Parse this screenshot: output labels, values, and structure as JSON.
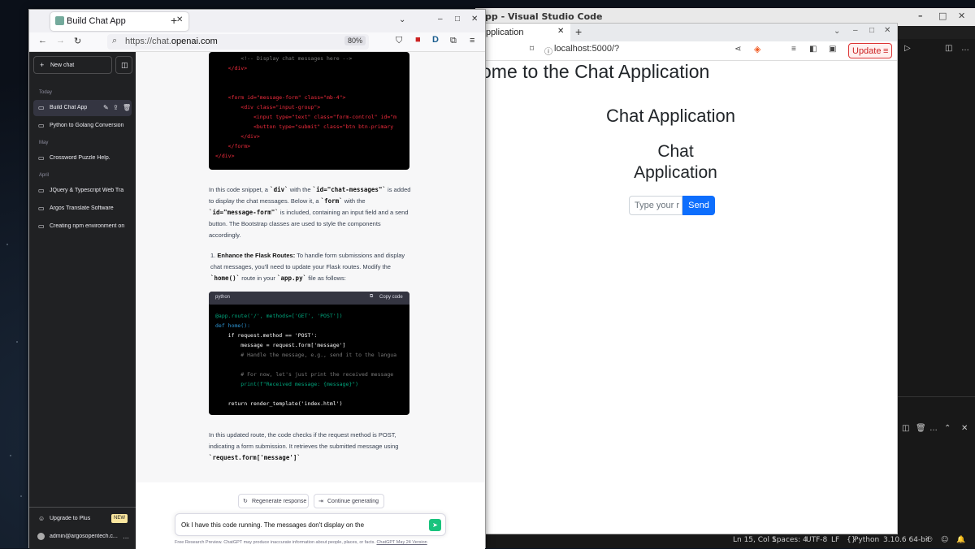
{
  "vscode": {
    "title": "pp - Visual Studio Code",
    "status": {
      "position": "Ln 15, Col 1",
      "spaces": "Spaces: 4",
      "encoding": "UTF-8",
      "eol": "LF",
      "language": "Python",
      "interpreter": "3.10.6 64-bit"
    }
  },
  "brave": {
    "tab_title": "pplication",
    "url": "localhost:5000/?",
    "update_label": "Update",
    "page": {
      "heading_main": "ome to the Chat Application",
      "heading_secondary": "Chat Application",
      "heading_tertiary": "Chat Application",
      "input_placeholder": "Type your r",
      "send_label": "Send"
    }
  },
  "firefox": {
    "tab_title": "Build Chat App",
    "url_prefix": "https://chat.",
    "url_domain": "openai.com",
    "zoom": "80%"
  },
  "sidebar": {
    "new_chat": "New chat",
    "sections": [
      {
        "label": "Today",
        "items": [
          {
            "label": "Build Chat App",
            "active": true
          },
          {
            "label": "Python to Golang Conversion",
            "active": false
          }
        ]
      },
      {
        "label": "May",
        "items": [
          {
            "label": "Crossword Puzzle Help.",
            "active": false
          }
        ]
      },
      {
        "label": "April",
        "items": [
          {
            "label": "JQuery & Typescript Web Tra",
            "active": false
          },
          {
            "label": "Argos Translate Software",
            "active": false
          },
          {
            "label": "Creating npm environment on",
            "active": false
          }
        ]
      }
    ],
    "upgrade_label": "Upgrade to Plus",
    "new_badge": "NEW",
    "account": "admin@argosopentech.c..."
  },
  "chat": {
    "code1_lines": [
      "        <!-- Display chat messages here -->",
      "    </div>",
      "",
      "    <form id=\"message-form\" class=\"mb-4\">",
      "        <div class=\"input-group\">",
      "            <input type=\"text\" class=\"form-control\" id=\"m",
      "            <button type=\"submit\" class=\"btn btn-primary",
      "        </div>",
      "    </form>",
      "</div>"
    ],
    "para1": {
      "t1": "In this code snippet, a ",
      "c1": "`div`",
      "t2": " with the ",
      "c2": "`id=\"chat-messages\"`",
      "t3": " is added to display the chat messages. Below it, a ",
      "c3": "`form`",
      "t4": " with the ",
      "c4": "`id=\"message-form\"`",
      "t5": " is included, containing an input field and a send button. The Bootstrap classes are used to style the components accordingly."
    },
    "list_item": {
      "number": "1.",
      "bold": "Enhance the Flask Routes:",
      "t1": " To handle form submissions and display chat messages, you'll need to update your Flask routes. Modify the ",
      "c1": "`home()`",
      "t2": " route in your ",
      "c2": "`app.py`",
      "t3": " file as follows:"
    },
    "code2_lang": "python",
    "code2_copy": "Copy code",
    "code2_lines": [
      "@app.route('/', methods=['GET', 'POST'])",
      "def home():",
      "    if request.method == 'POST':",
      "        message = request.form['message']",
      "        # Handle the message, e.g., send it to the langua",
      "",
      "        # For now, let's just print the received message",
      "        print(f\"Received message: {message}\")",
      "",
      "    return render_template('index.html')"
    ],
    "para2": {
      "t1": "In this updated route, the code checks if the request method is POST, indicating a form submission. It retrieves the submitted message using ",
      "c1": "`request.form['message']`"
    },
    "regenerate_label": "Regenerate response",
    "continue_label": "Continue generating",
    "prompt_text": "Ok I have this code running. The messages don't display on the",
    "disclaimer": "Free Research Preview. ChatGPT may produce inaccurate information about people, places, or facts.",
    "disclaimer_link": "ChatGPT May 24 Version"
  }
}
